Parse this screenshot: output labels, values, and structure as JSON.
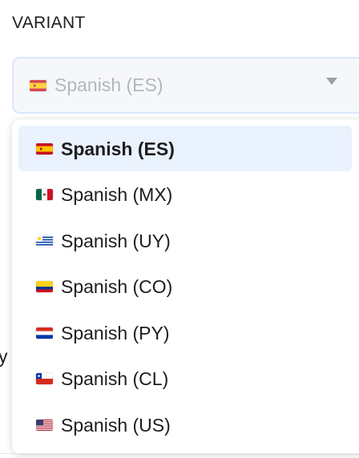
{
  "section": {
    "label": "VARIANT"
  },
  "select": {
    "value": "Spanish (ES)",
    "flag_icon": "spain-flag-icon"
  },
  "background_fragment": "y",
  "dropdown": {
    "options": [
      {
        "label": "Spanish (ES)",
        "flag_icon": "spain-flag-icon",
        "selected": true
      },
      {
        "label": "Spanish (MX)",
        "flag_icon": "mexico-flag-icon",
        "selected": false
      },
      {
        "label": "Spanish (UY)",
        "flag_icon": "uruguay-flag-icon",
        "selected": false
      },
      {
        "label": "Spanish (CO)",
        "flag_icon": "colombia-flag-icon",
        "selected": false
      },
      {
        "label": "Spanish (PY)",
        "flag_icon": "paraguay-flag-icon",
        "selected": false
      },
      {
        "label": "Spanish (CL)",
        "flag_icon": "chile-flag-icon",
        "selected": false
      },
      {
        "label": "Spanish (US)",
        "flag_icon": "usa-flag-icon",
        "selected": false
      }
    ]
  },
  "colors": {
    "selected_bg": "#eaf2fe",
    "focus_border": "#cfe0fb",
    "disabled_text": "#9a9ea6"
  }
}
